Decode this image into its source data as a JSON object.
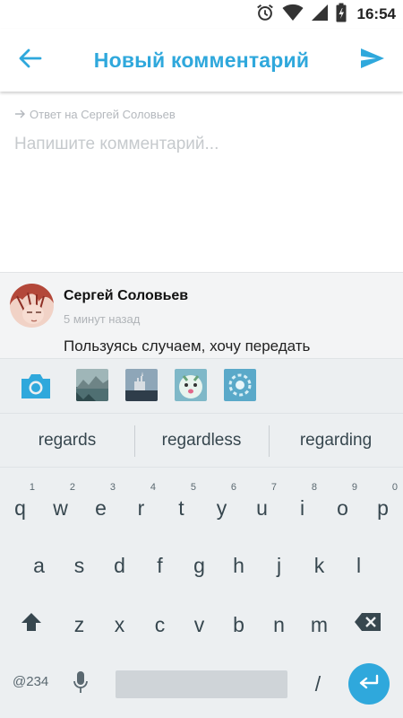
{
  "status_bar": {
    "time": "16:54"
  },
  "app_bar": {
    "title": "Новый комментарий"
  },
  "compose": {
    "reply_to": "Ответ на Сергей Соловьев",
    "placeholder": "Напишите комментарий..."
  },
  "quoted_comment": {
    "author": "Сергей Соловьев",
    "time_ago": "5 минут назад",
    "text": "Пользуясь случаем, хочу передать"
  },
  "suggestions": [
    "regards",
    "regardless",
    "regarding"
  ],
  "keyboard": {
    "row1": [
      {
        "key": "q",
        "hint": "1"
      },
      {
        "key": "w",
        "hint": "2"
      },
      {
        "key": "e",
        "hint": "3"
      },
      {
        "key": "r",
        "hint": "4"
      },
      {
        "key": "t",
        "hint": "5"
      },
      {
        "key": "y",
        "hint": "6"
      },
      {
        "key": "u",
        "hint": "7"
      },
      {
        "key": "i",
        "hint": "8"
      },
      {
        "key": "o",
        "hint": "9"
      },
      {
        "key": "p",
        "hint": "0"
      }
    ],
    "row2": [
      "a",
      "s",
      "d",
      "f",
      "g",
      "h",
      "j",
      "k",
      "l"
    ],
    "row3": [
      "z",
      "x",
      "c",
      "v",
      "b",
      "n",
      "m"
    ],
    "symbols_label": "@234",
    "slash": "/"
  },
  "colors": {
    "accent": "#2fa8dc",
    "keyboard_bg": "#eceff1",
    "key_text": "#37474f"
  },
  "icons": {
    "back": "arrow-left-icon",
    "send": "send-icon",
    "camera": "camera-icon",
    "shift": "shift-icon",
    "backspace": "backspace-icon",
    "mic": "mic-icon",
    "enter": "enter-icon"
  }
}
